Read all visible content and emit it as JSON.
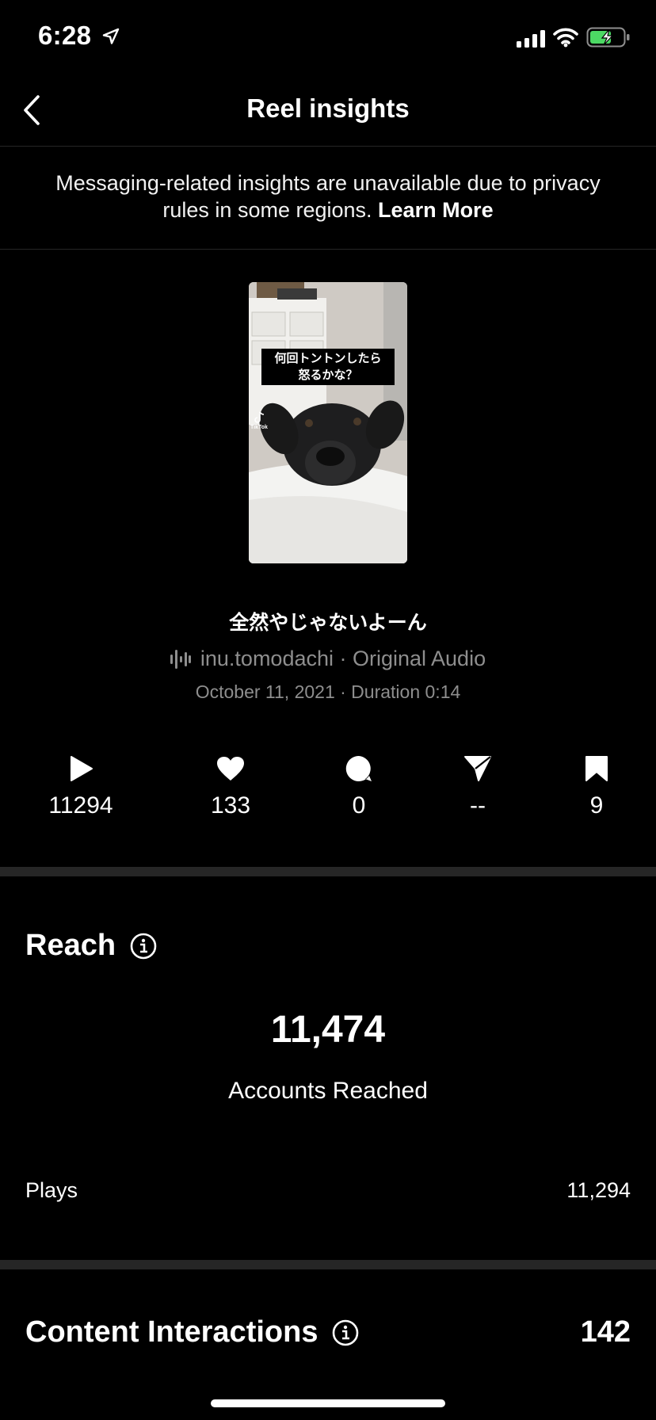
{
  "status_bar": {
    "time": "6:28"
  },
  "header": {
    "title": "Reel insights"
  },
  "notice": {
    "text": "Messaging-related insights are unavailable due to privacy rules in some regions.",
    "link_label": "Learn More"
  },
  "reel": {
    "thumbnail_caption_line1": "何回トントンしたら",
    "thumbnail_caption_line2": "怒るかな？",
    "thumbnail_watermark": "TikTok",
    "title": "全然やじゃないよーん",
    "audio": "inu.tomodachi · Original Audio",
    "meta": "October 11, 2021 · Duration 0:14"
  },
  "stats": [
    {
      "icon": "play-icon",
      "value": "11294"
    },
    {
      "icon": "heart-icon",
      "value": "133"
    },
    {
      "icon": "comment-icon",
      "value": "0"
    },
    {
      "icon": "share-icon",
      "value": "--"
    },
    {
      "icon": "bookmark-icon",
      "value": "9"
    }
  ],
  "reach": {
    "title": "Reach",
    "value": "11,474",
    "label": "Accounts Reached",
    "plays_label": "Plays",
    "plays_value": "11,294"
  },
  "content_interactions": {
    "title": "Content Interactions",
    "value": "142"
  },
  "colors": {
    "background": "#000000",
    "text": "#ffffff",
    "secondary_text": "#8e8e8e",
    "divider": "#262626",
    "battery_charging": "#4cd964"
  }
}
